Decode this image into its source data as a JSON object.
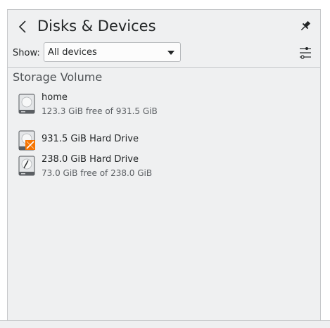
{
  "header": {
    "title": "Disks & Devices",
    "back_icon": "chevron-left-icon",
    "pin_icon": "pin-icon"
  },
  "filter": {
    "show_label": "Show:",
    "selected": "All devices",
    "settings_icon": "settings-sliders-icon"
  },
  "section": {
    "title": "Storage Volume"
  },
  "devices": [
    {
      "name": "home",
      "detail": "123.3 GiB free of 931.5 GiB",
      "icon": "hard-drive-icon"
    },
    {
      "name": "931.5 GiB Hard Drive",
      "detail": "",
      "icon": "hard-drive-unmounted-icon"
    },
    {
      "name": "238.0 GiB Hard Drive",
      "detail": "73.0 GiB free of 238.0 GiB",
      "icon": "hard-drive-icon"
    }
  ],
  "colors": {
    "background": "#eff0f1",
    "text": "#232627",
    "accent_orange": "#f67400"
  }
}
